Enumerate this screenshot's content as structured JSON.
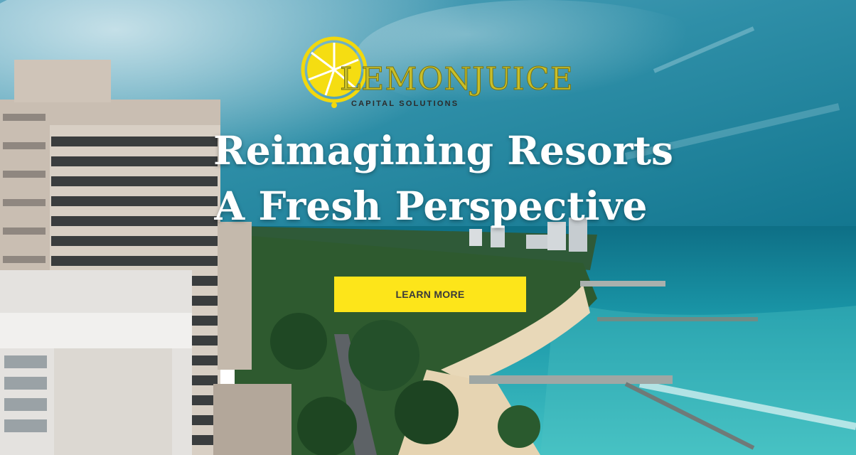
{
  "brand": {
    "name": "LEMONJUICE",
    "tagline": "CAPITAL   SOLUTIONS",
    "colors": {
      "lemon": "#f2d80c",
      "wordmark": "#c8bf2a",
      "cta": "#fde51a"
    }
  },
  "hero": {
    "headline_line1": "Reimagining Resorts",
    "headline_line2": "A Fresh Perspective",
    "cta_label": "LEARN MORE",
    "background": "aerial-beach-resort-photo"
  },
  "icons": {
    "logo_mark": "lemon-slice-icon"
  }
}
